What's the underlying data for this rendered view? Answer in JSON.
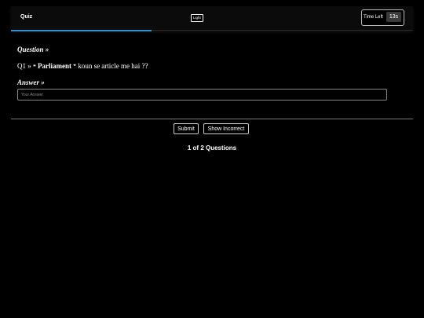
{
  "header": {
    "title": "Quiz",
    "theme_toggle_label": "Light",
    "timer_label": "Time Left",
    "timer_value": "13s",
    "progress_fraction": 0.35
  },
  "question": {
    "heading": "Question »",
    "prefix": "Q1 »",
    "open_quote": "❝",
    "keyword": "Parliament",
    "close_quote": "❞",
    "text": "koun se article me hai ??"
  },
  "answer": {
    "heading": "Answer »",
    "placeholder": "Your Answer",
    "value": ""
  },
  "actions": {
    "submit_label": "Submit",
    "show_incorrect_label": "Show Incorrect"
  },
  "footer": {
    "counter": "1 of 2 Questions"
  },
  "colors": {
    "background": "#000000",
    "progress": "#2e8fd1",
    "text": "#ffffff"
  }
}
